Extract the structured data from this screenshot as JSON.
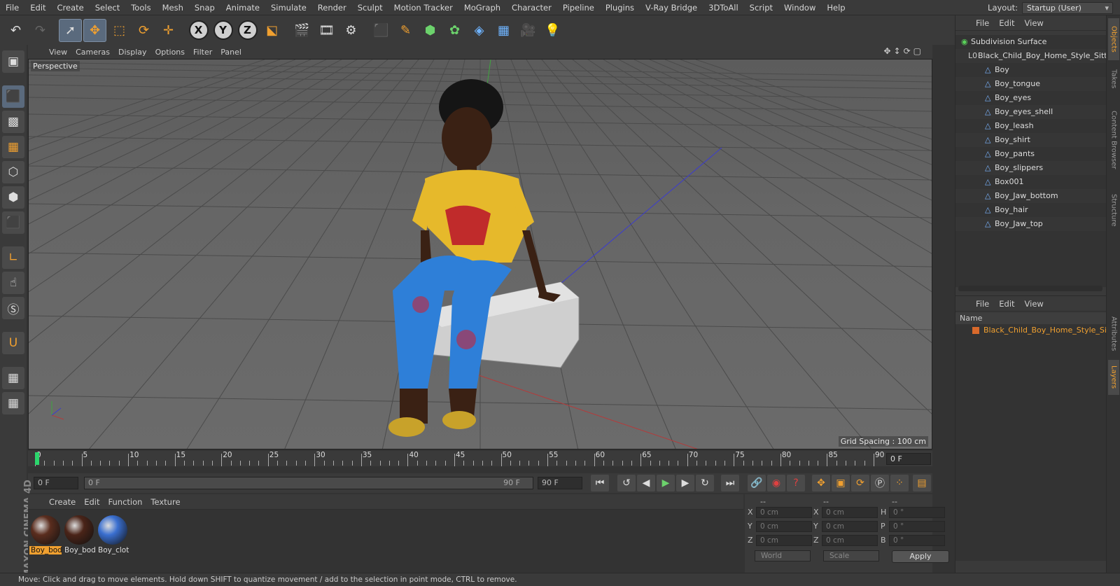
{
  "menu": [
    "File",
    "Edit",
    "Create",
    "Select",
    "Tools",
    "Mesh",
    "Snap",
    "Animate",
    "Simulate",
    "Render",
    "Sculpt",
    "Motion Tracker",
    "MoGraph",
    "Character",
    "Pipeline",
    "Plugins",
    "V-Ray Bridge",
    "3DToAll",
    "Script",
    "Window",
    "Help"
  ],
  "layout": {
    "label": "Layout:",
    "value": "Startup (User)"
  },
  "toolbar": {
    "axis_x": "X",
    "axis_y": "Y",
    "axis_z": "Z"
  },
  "viewport": {
    "menu": [
      "View",
      "Cameras",
      "Display",
      "Options",
      "Filter",
      "Panel"
    ],
    "label": "Perspective",
    "grid_spacing": "Grid Spacing : 100 cm"
  },
  "timeline": {
    "ticks": [
      "0",
      "5",
      "10",
      "15",
      "20",
      "25",
      "30",
      "35",
      "40",
      "45",
      "50",
      "55",
      "60",
      "65",
      "70",
      "75",
      "80",
      "85",
      "90"
    ],
    "current_frame": "0 F"
  },
  "transport": {
    "start_field": "0 F",
    "range_start": "0 F",
    "range_end": "90 F",
    "end_field": "90 F"
  },
  "materials": {
    "menu": [
      "Create",
      "Edit",
      "Function",
      "Texture"
    ],
    "items": [
      {
        "name": "Boy_body",
        "color": "#5a2d1e"
      },
      {
        "name": "Boy_body",
        "color": "#4a2418"
      },
      {
        "name": "Boy_cloth",
        "color": "#3a6fd0"
      }
    ]
  },
  "coords": {
    "header": [
      "--",
      "--",
      "--"
    ],
    "rows": [
      {
        "a": "X",
        "av": "0 cm",
        "b": "X",
        "bv": "0 cm",
        "c": "H",
        "cv": "0 °"
      },
      {
        "a": "Y",
        "av": "0 cm",
        "b": "Y",
        "bv": "0 cm",
        "c": "P",
        "cv": "0 °"
      },
      {
        "a": "Z",
        "av": "0 cm",
        "b": "Z",
        "bv": "0 cm",
        "c": "B",
        "cv": "0 °"
      }
    ],
    "world": "World",
    "scale": "Scale",
    "apply": "Apply"
  },
  "brand": "MAXON CINEMA 4D",
  "status": "Move: Click and drag to move elements. Hold down SHIFT to quantize movement / add to the selection in point mode, CTRL to remove.",
  "objects": {
    "menu": [
      "File",
      "Edit",
      "View"
    ],
    "root": "Subdivision Surface",
    "group": "Black_Child_Boy_Home_Style_Sitting",
    "children": [
      "Boy",
      "Boy_tongue",
      "Boy_eyes",
      "Boy_eyes_shell",
      "Boy_leash",
      "Boy_shirt",
      "Boy_pants",
      "Boy_slippers",
      "Box001",
      "Boy_Jaw_bottom",
      "Boy_hair",
      "Boy_Jaw_top"
    ]
  },
  "layers": {
    "menu": [
      "File",
      "Edit",
      "View"
    ],
    "col_header": "Name",
    "row": "Black_Child_Boy_Home_Style_Sitting"
  },
  "side_tabs": [
    "Objects",
    "Takes",
    "Content Browser",
    "Structure",
    "Attributes",
    "Layers"
  ]
}
